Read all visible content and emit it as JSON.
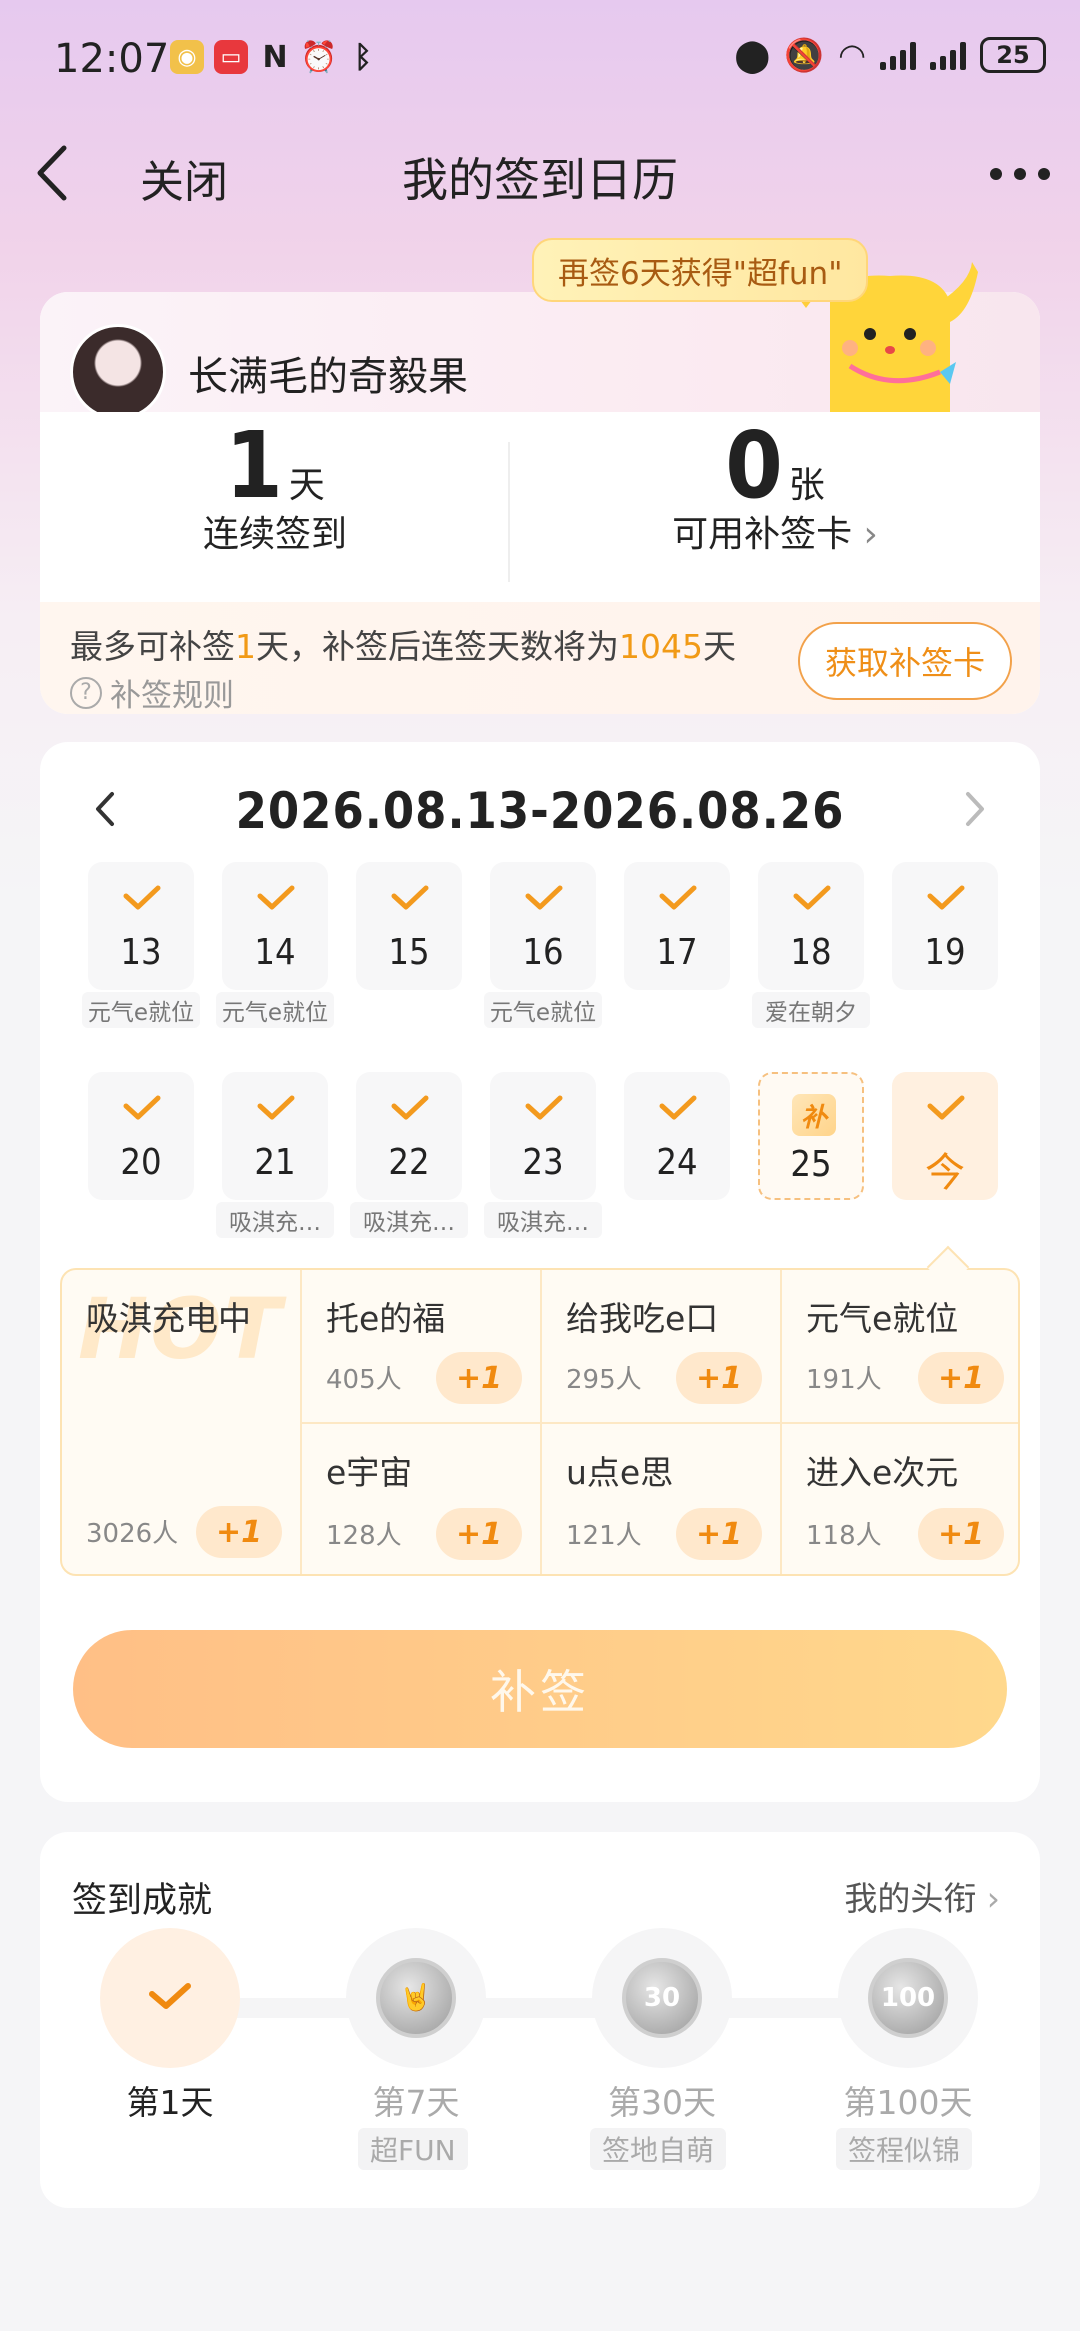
{
  "status_bar": {
    "time": "12:07",
    "battery": "25"
  },
  "nav": {
    "close": "关闭",
    "title": "我的签到日历"
  },
  "promo": {
    "text": "再签6天获得\"超fun\""
  },
  "profile": {
    "username": "长满毛的奇毅果"
  },
  "stats": {
    "streak": {
      "value": "1",
      "unit": "天",
      "label": "连续签到"
    },
    "cards": {
      "value": "0",
      "unit": "张",
      "label": "可用补签卡"
    }
  },
  "makeup_info": {
    "prefix": "最多可补签",
    "days": "1",
    "middle": "天，补签后连签天数将为",
    "total": "1045",
    "suffix": "天",
    "rule": "补签规则",
    "get_card": "获取补签卡"
  },
  "calendar": {
    "range": "2026.08.13-2026.08.26",
    "days": [
      {
        "num": "13",
        "state": "signed",
        "tag": "元气e就位"
      },
      {
        "num": "14",
        "state": "signed",
        "tag": "元气e就位"
      },
      {
        "num": "15",
        "state": "signed",
        "tag": ""
      },
      {
        "num": "16",
        "state": "signed",
        "tag": "元气e就位"
      },
      {
        "num": "17",
        "state": "signed",
        "tag": ""
      },
      {
        "num": "18",
        "state": "signed",
        "tag": "爱在朝夕"
      },
      {
        "num": "19",
        "state": "signed",
        "tag": ""
      },
      {
        "num": "20",
        "state": "signed",
        "tag": ""
      },
      {
        "num": "21",
        "state": "signed",
        "tag": "吸淇充…"
      },
      {
        "num": "22",
        "state": "signed",
        "tag": "吸淇充…"
      },
      {
        "num": "23",
        "state": "signed",
        "tag": "吸淇充…"
      },
      {
        "num": "24",
        "state": "signed",
        "tag": ""
      },
      {
        "num": "25",
        "state": "makeup",
        "badge": "补",
        "tag": ""
      },
      {
        "num": "今",
        "state": "today",
        "tag": ""
      }
    ]
  },
  "topics": {
    "hot_watermark": "HOT",
    "featured": {
      "name": "吸淇充电中",
      "count": "3026人",
      "plus": "+1"
    },
    "items": [
      {
        "name": "托e的福",
        "count": "405人",
        "plus": "+1"
      },
      {
        "name": "给我吃e口",
        "count": "295人",
        "plus": "+1"
      },
      {
        "name": "元气e就位",
        "count": "191人",
        "plus": "+1"
      },
      {
        "name": "e宇宙",
        "count": "128人",
        "plus": "+1"
      },
      {
        "name": "u点e思",
        "count": "121人",
        "plus": "+1"
      },
      {
        "name": "进入e次元",
        "count": "118人",
        "plus": "+1"
      }
    ]
  },
  "makeup_button": "补签",
  "achievements": {
    "title": "签到成就",
    "link": "我的头衔",
    "milestones": [
      {
        "label": "第1天",
        "badge": "",
        "done": true
      },
      {
        "label": "第7天",
        "badge": "超FUN",
        "done": false,
        "icon": "horn-hand-medal"
      },
      {
        "label": "第30天",
        "badge": "签地自萌",
        "done": false,
        "icon_text": "30"
      },
      {
        "label": "第100天",
        "badge": "签程似锦",
        "done": false,
        "icon_text": "100"
      }
    ]
  },
  "colors": {
    "accent": "#f08a10",
    "button": "#ffc98a",
    "tag_bg": "#f6f6f7"
  }
}
